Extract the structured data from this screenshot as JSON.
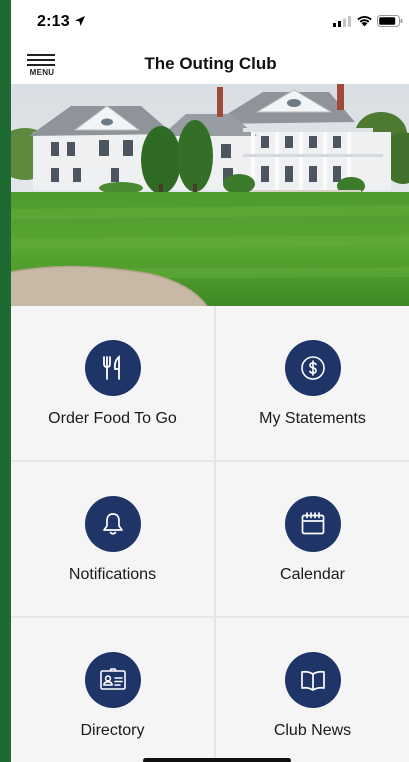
{
  "status_bar": {
    "time": "2:13"
  },
  "header": {
    "menu_label": "MENU",
    "title": "The Outing Club"
  },
  "tiles": [
    {
      "label": "Order Food To Go",
      "icon": "utensils-icon"
    },
    {
      "label": "My Statements",
      "icon": "dollar-icon"
    },
    {
      "label": "Notifications",
      "icon": "bell-icon"
    },
    {
      "label": "Calendar",
      "icon": "calendar-icon"
    },
    {
      "label": "Directory",
      "icon": "id-card-icon"
    },
    {
      "label": "Club News",
      "icon": "book-icon"
    }
  ],
  "colors": {
    "brand_green": "#1d6b33",
    "icon_circle": "#1f3568",
    "tile_bg": "#f5f5f5"
  }
}
